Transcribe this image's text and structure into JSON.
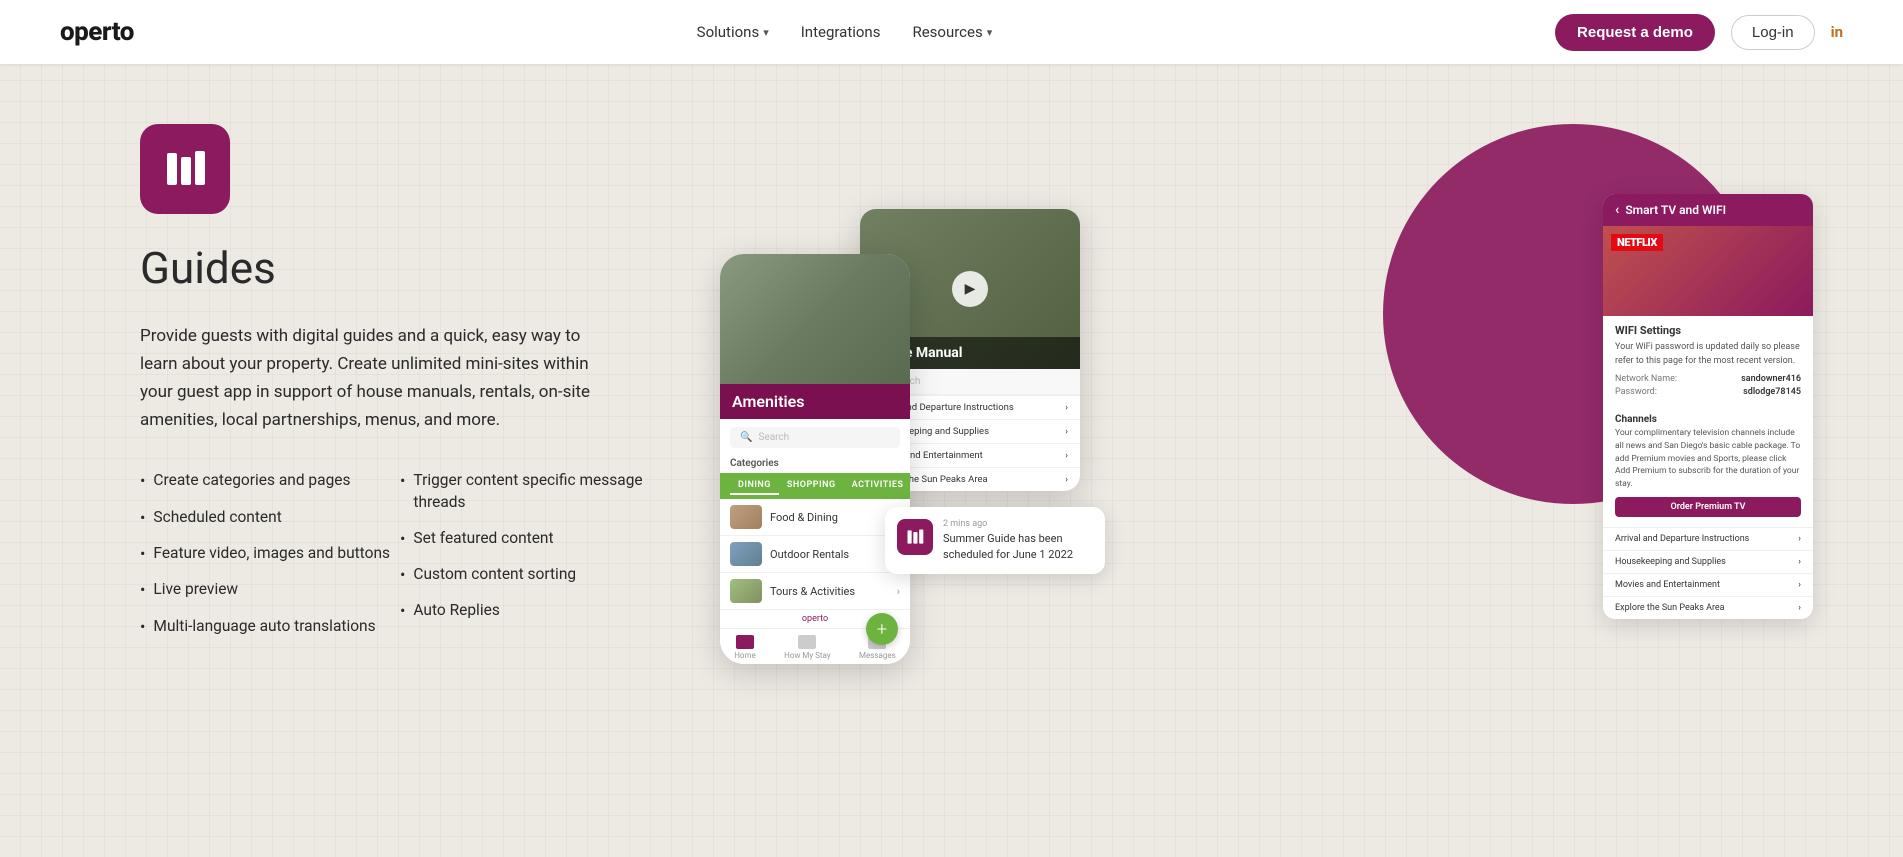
{
  "nav": {
    "logo": "operto",
    "links": [
      {
        "label": "Solutions",
        "hasDropdown": true
      },
      {
        "label": "Integrations",
        "hasDropdown": false
      },
      {
        "label": "Resources",
        "hasDropdown": true
      }
    ],
    "cta_label": "Request a demo",
    "login_label": "Log-in",
    "social_label": "in"
  },
  "hero": {
    "icon_label": "guides-icon",
    "title": "Guides",
    "description": "Provide guests with digital guides and a quick, easy way to learn about your property. Create unlimited mini-sites within your guest app in support of house manuals, rentals, on-site amenities, local partnerships, menus, and more.",
    "features_left": [
      "Create categories and pages",
      "Scheduled content",
      "Feature video, images and buttons",
      "Live preview",
      "Multi-language auto translations"
    ],
    "features_right": [
      "Trigger content specific message threads",
      "Set featured content",
      "Custom content sorting",
      "Auto Replies"
    ]
  },
  "mockup": {
    "house_manual_title": "House Manual",
    "amenities_title": "Amenities",
    "categories_label": "Categories",
    "search_label": "Search",
    "tabs": [
      "DINING",
      "SHOPPING",
      "ACTIVITIES"
    ],
    "list_items": [
      "Food & Dining",
      "Outdoor Rentals",
      "Tours & Activities"
    ],
    "wifi_header": "Smart TV and WIFI",
    "wifi_section": "WIFI Settings",
    "wifi_desc": "Your WiFi password is updated daily so please refer to this page for the most recent version.",
    "wifi_network_label": "Network Name:",
    "wifi_network_value": "sandowner416",
    "wifi_password_label": "Password:",
    "wifi_password_value": "sdlodge78145",
    "channels_title": "Channels",
    "channels_desc": "Your complimentary television channels include all news and San Diego's basic cable package. To add Premium movies and Sports, please click Add Premium to subscrib for the duration of your stay.",
    "order_btn_label": "Order Premium TV",
    "wifi_list_items": [
      "Arrival and Departure Instructions",
      "Housekeeping and Supplies",
      "Movies and Entertainment",
      "Explore the Sun Peaks Area"
    ],
    "notification_time": "2 mins ago",
    "notification_text": "Summer Guide has been scheduled for June 1 2022",
    "operto_label": "operto"
  }
}
